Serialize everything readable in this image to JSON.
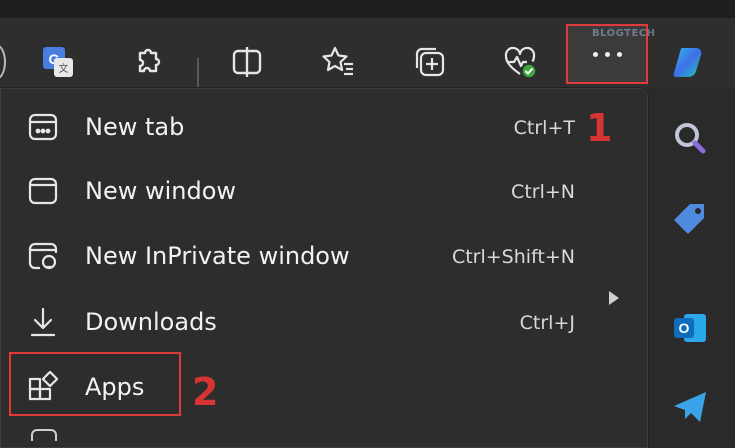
{
  "toolbar": {
    "icons": [
      "translate-icon",
      "extensions-icon",
      "split-screen-icon",
      "favorites-icon",
      "collections-icon",
      "browser-essentials-icon"
    ],
    "more_button_icon": "more-dots-icon",
    "watermark": "BLOGTECH"
  },
  "menu": {
    "items": [
      {
        "label": "New tab",
        "shortcut": "Ctrl+T",
        "icon": "new-tab-icon"
      },
      {
        "label": "New window",
        "shortcut": "Ctrl+N",
        "icon": "new-window-icon"
      },
      {
        "label": "New InPrivate window",
        "shortcut": "Ctrl+Shift+N",
        "icon": "inprivate-icon"
      },
      {
        "label": "Downloads",
        "shortcut": "Ctrl+J",
        "icon": "download-icon"
      },
      {
        "label": "Apps",
        "shortcut": "",
        "icon": "apps-icon"
      }
    ]
  },
  "annotations": {
    "step1": "1",
    "step2": "2"
  },
  "sidebar": {
    "icons": [
      "copilot-icon",
      "search-icon",
      "shopping-tag-icon",
      "outlook-icon",
      "telegram-icon"
    ]
  },
  "colors": {
    "highlight": "#e03a3a",
    "background": "#2d2d2d"
  }
}
